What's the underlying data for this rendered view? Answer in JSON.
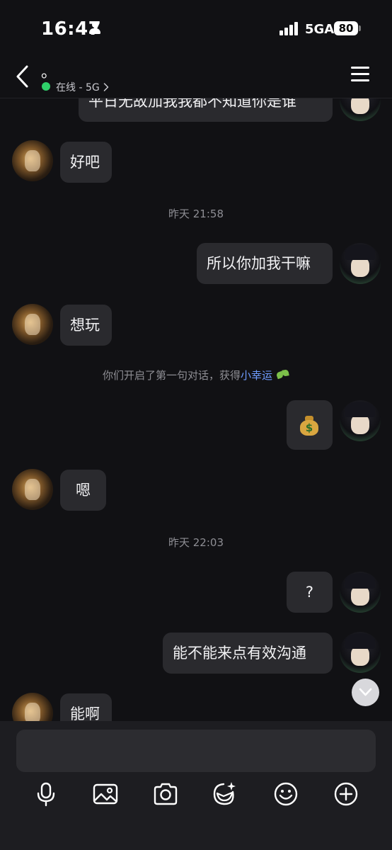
{
  "status_bar": {
    "time": "16:47",
    "network": "5GA",
    "battery": "80"
  },
  "header": {
    "title": "。",
    "status": "在线 - 5G"
  },
  "chat": {
    "top_partial": "平日无故加我我都不知道你是谁",
    "msg_haoba": "好吧",
    "time_1": "昨天 21:58",
    "msg_suoyi": "所以你加我干嘛",
    "msg_xiangwan": "想玩",
    "system_prefix": "你们开启了第一句对话，获得",
    "system_highlight": "小幸运",
    "moneybag_symbol": "$",
    "msg_en": "嗯",
    "time_2": "昨天 22:03",
    "msg_question": "?",
    "msg_nengbuneng": "能不能来点有效沟通",
    "msg_nenga": "能啊"
  },
  "input": {
    "placeholder": ""
  },
  "toolbar": [
    "microphone-icon",
    "image-icon",
    "camera-icon",
    "sticker-icon",
    "emoji-icon",
    "add-icon"
  ],
  "colors": {
    "background": "#111114",
    "bubble": "#2a2a2e",
    "online": "#2fd06a",
    "highlight": "#6f9cff"
  }
}
